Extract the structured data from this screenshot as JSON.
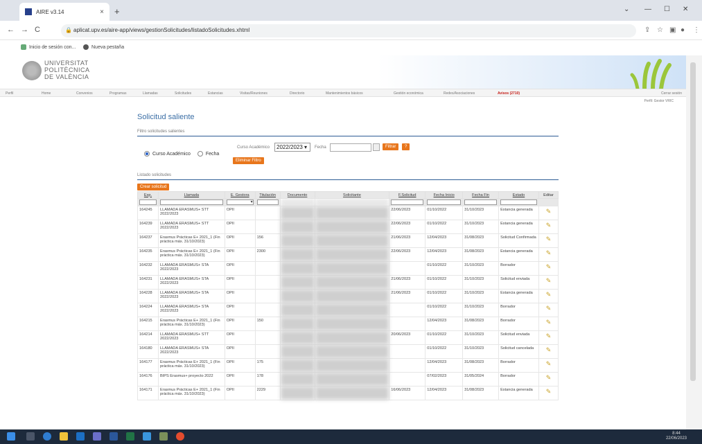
{
  "browser": {
    "tab_title": "AIRE v3.14",
    "tab_close": "×",
    "new_tab": "+",
    "url": "aplicat.upv.es/aire-app/views/gestionSolicitudes/listadoSolicitudes.xhtml",
    "bookmarks": [
      "Inicio de sesión con...",
      "Nueva pestaña"
    ]
  },
  "header": {
    "university": [
      "UNIVERSITAT",
      "POLITÈCNICA",
      "DE VALÈNCIA"
    ]
  },
  "menu": {
    "items": [
      "Perfil",
      "Home",
      "Convenios",
      "Programas",
      "Llamadas",
      "Solicitudes",
      "Estancias",
      "Visitas/Reuniones",
      "Directorio",
      "Mantenimientos básicos",
      "Gestión económica",
      "Redes/Asociaciones"
    ],
    "avisos": "Avisos (2710)",
    "cerrar": "Cerrar sesión",
    "perfil": "Perfil: Gestor VRIC"
  },
  "page": {
    "title": "Solicitud saliente",
    "filter_section": "Filtro solicitudes salientes",
    "radio_curso": "Curso Académico",
    "radio_fecha": "Fecha",
    "curso_label": "Curso Académico",
    "curso_value": "2022/2023 ▾",
    "fecha_label": "Fecha",
    "btn_filtrar": "Filtrar",
    "btn_help": "?",
    "btn_eliminar": "Eliminar Filtro",
    "list_section": "Listado solicitudes",
    "btn_crear": "Crear solicitud"
  },
  "table": {
    "headers": [
      "Exp.",
      "Llamada",
      "E. Gestora",
      "Titulación",
      "Documento",
      "Solicitante",
      "F.Solicitud",
      "Fecha Inicio",
      "Fecha Fin",
      "Estado",
      "Editar"
    ],
    "rows": [
      [
        "164245",
        "LLAMADA ERASMUS+ STT 2022/2023",
        "OPII",
        "",
        "22/06/2023",
        "01/10/2022",
        "31/10/2023",
        "Estancia generada"
      ],
      [
        "164239",
        "LLAMADA ERASMUS+ STT 2022/2023",
        "OPII",
        "",
        "22/06/2023",
        "01/10/2022",
        "31/10/2023",
        "Estancia generada"
      ],
      [
        "164237",
        "Erasmus Prácticas E+ 2021_1 (Fin práctica máx. 31/10/2023)",
        "OPII",
        "156",
        "21/06/2023",
        "12/04/2023",
        "31/08/2023",
        "Solicitud Confirmada"
      ],
      [
        "164235",
        "Erasmus Prácticas E+ 2021_1 (Fin práctica máx. 31/10/2023)",
        "OPII",
        "2300",
        "22/06/2023",
        "12/04/2023",
        "31/08/2023",
        "Estancia generada"
      ],
      [
        "164232",
        "LLAMADA ERASMUS+ STA 2022/2023",
        "OPII",
        "",
        "",
        "01/10/2022",
        "31/10/2023",
        "Borrador"
      ],
      [
        "164231",
        "LLAMADA ERASMUS+ STA 2022/2023",
        "OPII",
        "",
        "21/06/2023",
        "01/10/2022",
        "31/10/2023",
        "Solicitud enviada"
      ],
      [
        "164228",
        "LLAMADA ERASMUS+ STA 2022/2023",
        "OPII",
        "",
        "21/06/2023",
        "01/10/2022",
        "31/10/2023",
        "Estancia generada"
      ],
      [
        "164224",
        "LLAMADA ERASMUS+ STA 2022/2023",
        "OPII",
        "",
        "",
        "01/10/2022",
        "31/10/2023",
        "Borrador"
      ],
      [
        "164215",
        "Erasmus Prácticas E+ 2021_1 (Fin práctica máx. 31/10/2023)",
        "OPII",
        "150",
        "",
        "12/04/2023",
        "31/08/2023",
        "Borrador"
      ],
      [
        "164214",
        "LLAMADA ERASMUS+ STT 2022/2023",
        "OPII",
        "",
        "20/06/2023",
        "01/10/2022",
        "31/10/2023",
        "Solicitud enviada"
      ],
      [
        "164180",
        "LLAMADA ERASMUS+ STA 2022/2023",
        "OPII",
        "",
        "",
        "01/10/2022",
        "31/10/2023",
        "Solicitud cancelada"
      ],
      [
        "164177",
        "Erasmus Prácticas E+ 2021_1 (Fin práctica máx. 31/10/2023)",
        "OPII",
        "175",
        "",
        "12/04/2023",
        "31/08/2023",
        "Borrador"
      ],
      [
        "164176",
        "BIPS Erasmus+ proyecto 2022",
        "OPII",
        "178",
        "",
        "07/02/2023",
        "31/05/2024",
        "Borrador"
      ],
      [
        "164171",
        "Erasmus Prácticas E+ 2021_1 (Fin práctica máx. 31/10/2023)",
        "OPII",
        "2229",
        "16/06/2023",
        "12/04/2023",
        "31/08/2023",
        "Estancia generada"
      ]
    ]
  },
  "taskbar": {
    "time": "8:44",
    "date": "22/06/2023"
  },
  "colors": {
    "accent_orange": "#e8761c",
    "title_blue": "#3a6ea5",
    "alert_red": "#c5201a"
  }
}
